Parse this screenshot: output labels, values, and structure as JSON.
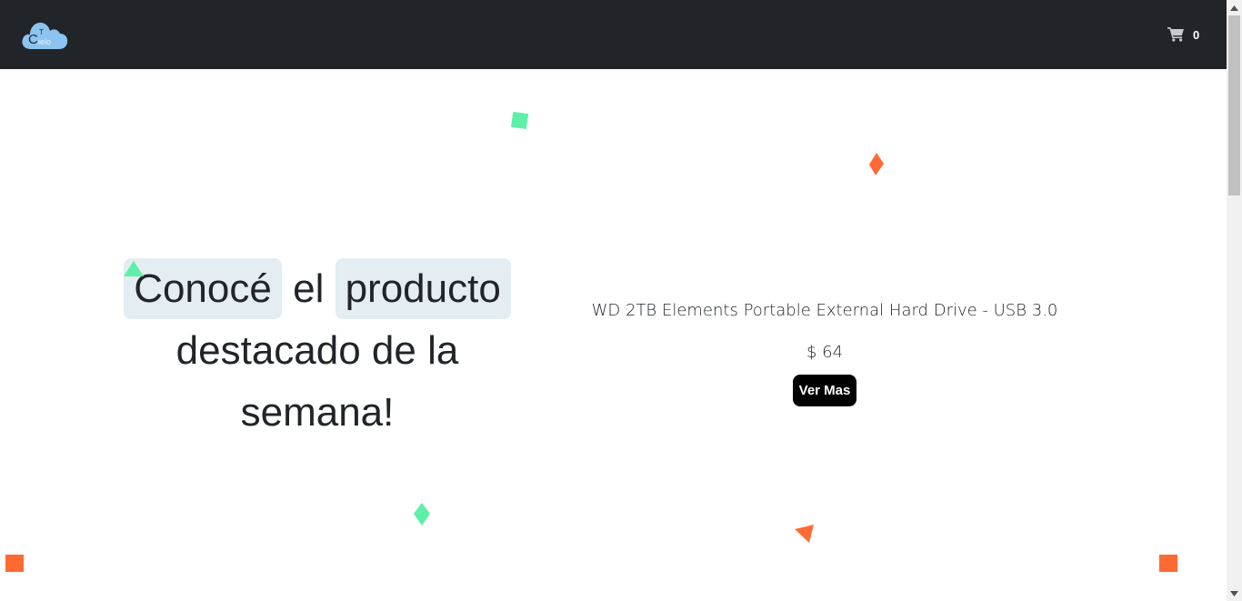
{
  "navbar": {
    "logo": {
      "letter_c": "C",
      "letter_t": "T",
      "text_ielo": "ielo"
    },
    "cart": {
      "icon": "shopping-cart-icon",
      "count": "0"
    }
  },
  "hero": {
    "word1": "Conocé",
    "word2": "el",
    "word3": "producto",
    "rest": "destacado de la semana!"
  },
  "product": {
    "title": "WD 2TB Elements Portable External Hard Drive - USB 3.0",
    "price": "$ 64",
    "button_label": "Ver Mas"
  },
  "colors": {
    "navbar_bg": "#212529",
    "highlight_bg": "#e3edf2",
    "confetti_green": "#5ef0a8",
    "confetti_orange": "#ff6a33",
    "button_bg": "#000000"
  }
}
